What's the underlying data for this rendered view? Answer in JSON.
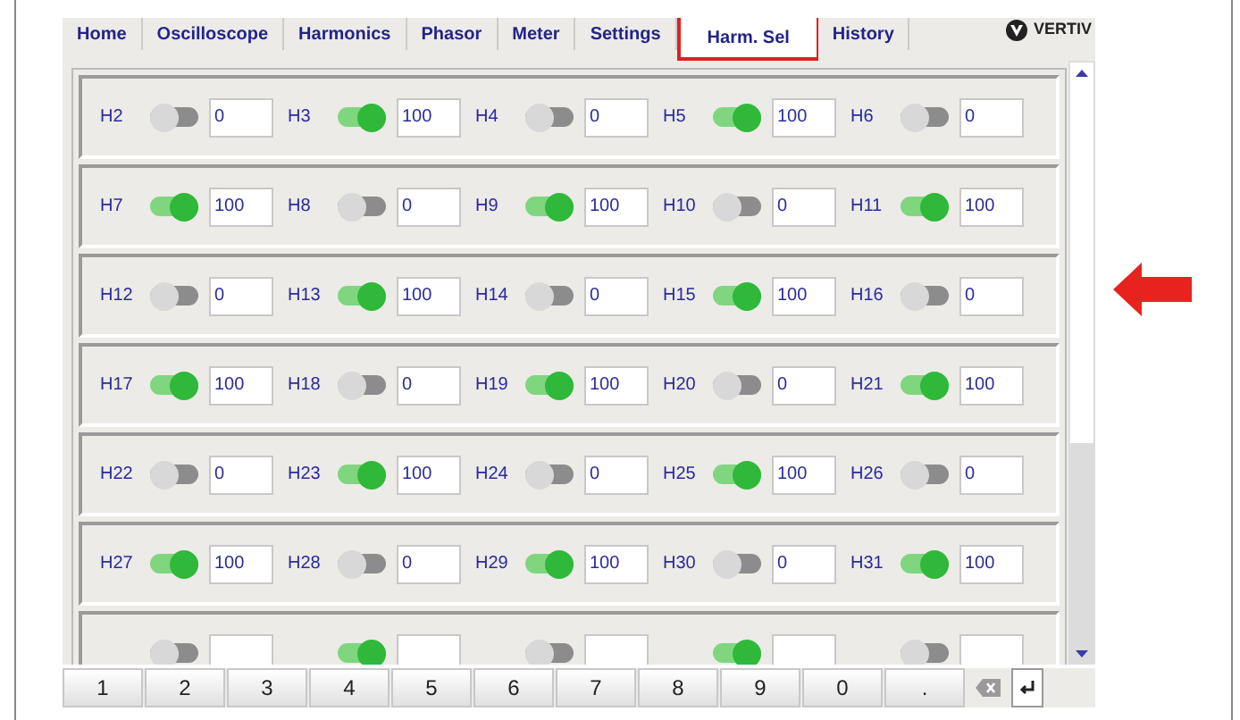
{
  "tabs": [
    {
      "label": "Home",
      "selected": false,
      "highlighted": false
    },
    {
      "label": "Oscilloscope",
      "selected": false,
      "highlighted": false
    },
    {
      "label": "Harmonics",
      "selected": false,
      "highlighted": false
    },
    {
      "label": "Phasor",
      "selected": false,
      "highlighted": false
    },
    {
      "label": "Meter",
      "selected": false,
      "highlighted": false
    },
    {
      "label": "Settings",
      "selected": false,
      "highlighted": false
    },
    {
      "label": "Harm. Sel",
      "selected": true,
      "highlighted": true
    },
    {
      "label": "History",
      "selected": false,
      "highlighted": false
    }
  ],
  "brand": "VERTIV",
  "harmonic_rows": [
    [
      {
        "label": "H2",
        "on": false,
        "value": "0"
      },
      {
        "label": "H3",
        "on": true,
        "value": "100"
      },
      {
        "label": "H4",
        "on": false,
        "value": "0"
      },
      {
        "label": "H5",
        "on": true,
        "value": "100"
      },
      {
        "label": "H6",
        "on": false,
        "value": "0"
      }
    ],
    [
      {
        "label": "H7",
        "on": true,
        "value": "100"
      },
      {
        "label": "H8",
        "on": false,
        "value": "0"
      },
      {
        "label": "H9",
        "on": true,
        "value": "100"
      },
      {
        "label": "H10",
        "on": false,
        "value": "0"
      },
      {
        "label": "H11",
        "on": true,
        "value": "100"
      }
    ],
    [
      {
        "label": "H12",
        "on": false,
        "value": "0"
      },
      {
        "label": "H13",
        "on": true,
        "value": "100"
      },
      {
        "label": "H14",
        "on": false,
        "value": "0"
      },
      {
        "label": "H15",
        "on": true,
        "value": "100"
      },
      {
        "label": "H16",
        "on": false,
        "value": "0"
      }
    ],
    [
      {
        "label": "H17",
        "on": true,
        "value": "100"
      },
      {
        "label": "H18",
        "on": false,
        "value": "0"
      },
      {
        "label": "H19",
        "on": true,
        "value": "100"
      },
      {
        "label": "H20",
        "on": false,
        "value": "0"
      },
      {
        "label": "H21",
        "on": true,
        "value": "100"
      }
    ],
    [
      {
        "label": "H22",
        "on": false,
        "value": "0"
      },
      {
        "label": "H23",
        "on": true,
        "value": "100"
      },
      {
        "label": "H24",
        "on": false,
        "value": "0"
      },
      {
        "label": "H25",
        "on": true,
        "value": "100"
      },
      {
        "label": "H26",
        "on": false,
        "value": "0"
      }
    ],
    [
      {
        "label": "H27",
        "on": true,
        "value": "100"
      },
      {
        "label": "H28",
        "on": false,
        "value": "0"
      },
      {
        "label": "H29",
        "on": true,
        "value": "100"
      },
      {
        "label": "H30",
        "on": false,
        "value": "0"
      },
      {
        "label": "H31",
        "on": true,
        "value": "100"
      }
    ],
    [
      {
        "on": false
      },
      {
        "on": true
      },
      {
        "on": false
      },
      {
        "on": true
      },
      {
        "on": false
      }
    ]
  ],
  "keypad": [
    {
      "kind": "text",
      "label": "1"
    },
    {
      "kind": "text",
      "label": "2"
    },
    {
      "kind": "text",
      "label": "3"
    },
    {
      "kind": "text",
      "label": "4"
    },
    {
      "kind": "text",
      "label": "5"
    },
    {
      "kind": "text",
      "label": "6"
    },
    {
      "kind": "text",
      "label": "7"
    },
    {
      "kind": "text",
      "label": "8"
    },
    {
      "kind": "text",
      "label": "9"
    },
    {
      "kind": "text",
      "label": "0"
    },
    {
      "kind": "text",
      "label": "."
    },
    {
      "kind": "backspace"
    },
    {
      "kind": "enter"
    }
  ],
  "annotation_arrow": true
}
